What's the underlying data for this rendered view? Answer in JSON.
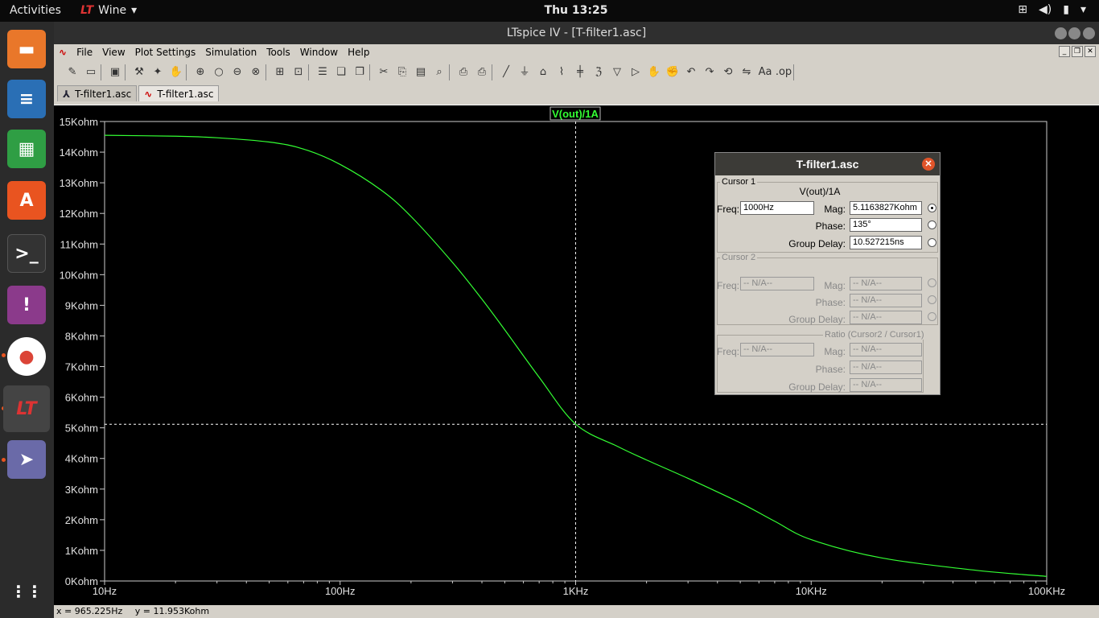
{
  "topbar": {
    "activities": "Activities",
    "app_name": "Wine",
    "clock": "Thu 13:25"
  },
  "window": {
    "title": "LTspice IV - [T-filter1.asc]"
  },
  "menu": [
    "File",
    "View",
    "Plot Settings",
    "Simulation",
    "Tools",
    "Window",
    "Help"
  ],
  "tabs": [
    {
      "label": "T-filter1.asc",
      "icon": "schematic-icon"
    },
    {
      "label": "T-filter1.asc",
      "icon": "waveform-icon"
    }
  ],
  "plot": {
    "trace_label": "V(out)/1A",
    "trace_color": "#33ff33"
  },
  "chart_data": {
    "type": "line",
    "title": "V(out)/1A",
    "xscale": "log",
    "xlim": [
      10,
      100000
    ],
    "ylim": [
      0,
      15
    ],
    "xticks": [
      "10Hz",
      "100Hz",
      "1KHz",
      "10KHz",
      "100KHz"
    ],
    "yticks": [
      "0Kohm",
      "1Kohm",
      "2Kohm",
      "3Kohm",
      "4Kohm",
      "5Kohm",
      "6Kohm",
      "7Kohm",
      "8Kohm",
      "9Kohm",
      "10Kohm",
      "11Kohm",
      "12Kohm",
      "13Kohm",
      "14Kohm",
      "15Kohm"
    ],
    "series": [
      {
        "name": "V(out)/1A",
        "x": [
          10,
          20,
          30,
          50,
          70,
          100,
          150,
          200,
          300,
          400,
          500,
          700,
          1000,
          1500,
          2000,
          3000,
          5000,
          7000,
          10000,
          20000,
          50000,
          100000
        ],
        "y": [
          14.55,
          14.52,
          14.47,
          14.33,
          14.1,
          13.6,
          12.75,
          11.9,
          10.4,
          9.2,
          8.2,
          6.65,
          5.12,
          4.4,
          3.95,
          3.35,
          2.55,
          1.95,
          1.35,
          0.75,
          0.35,
          0.15
        ]
      }
    ],
    "cursor": {
      "x": 1000,
      "y": 5.1163827
    }
  },
  "dialog": {
    "title": "T-filter1.asc",
    "cursor1": {
      "legend": "Cursor 1",
      "trace": "V(out)/1A",
      "freq_label": "Freq:",
      "freq": "1000Hz",
      "mag_label": "Mag:",
      "mag": "5.1163827Kohm",
      "phase_label": "Phase:",
      "phase": "135°",
      "gd_label": "Group Delay:",
      "gd": "10.527215ns"
    },
    "cursor2": {
      "legend": "Cursor 2",
      "freq_label": "Freq:",
      "freq": "-- N/A--",
      "mag_label": "Mag:",
      "mag": "-- N/A--",
      "phase_label": "Phase:",
      "phase": "-- N/A--",
      "gd_label": "Group Delay:",
      "gd": "-- N/A--"
    },
    "ratio": {
      "legend": "Ratio (Cursor2 / Cursor1)",
      "freq_label": "Freq:",
      "freq": "-- N/A--",
      "mag_label": "Mag:",
      "mag": "-- N/A--",
      "phase_label": "Phase:",
      "phase": "-- N/A--",
      "gd_label": "Group Delay:",
      "gd": "-- N/A--"
    }
  },
  "status": {
    "x": "x = 965.225Hz",
    "y": "y = 11.953Kohm"
  }
}
